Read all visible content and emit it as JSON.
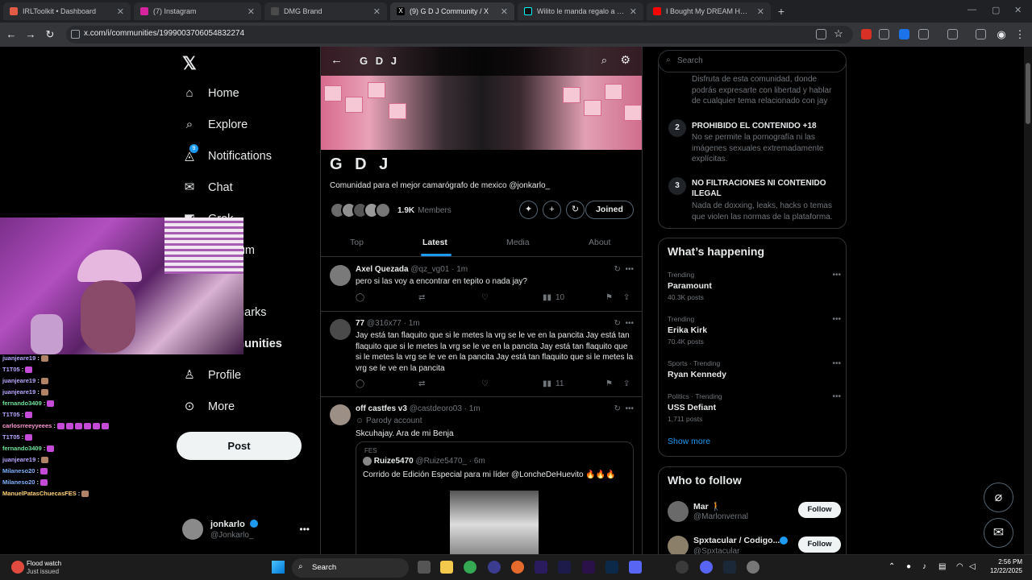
{
  "browser": {
    "tabs": [
      {
        "label": "IRLToolkit • Dashboard",
        "color": "#e25b45"
      },
      {
        "label": "(7) Instagram",
        "color": "#d6249f"
      },
      {
        "label": "DMG Brand",
        "color": "#4a4a4a"
      },
      {
        "label": "(9) G D J Community / X",
        "color": "#000000"
      },
      {
        "label": "Wilito le manda regalo a Sabina",
        "color": "#111111"
      },
      {
        "label": "I Bought My DREAM HOUSE At",
        "color": "#ff0000"
      }
    ],
    "url": "x.com/i/communities/1999003706054832274"
  },
  "nav": {
    "items": [
      {
        "label": "Home",
        "icon": "home-icon",
        "glyph": "⌂"
      },
      {
        "label": "Explore",
        "icon": "search-icon",
        "glyph": "⌕"
      },
      {
        "label": "Notifications",
        "icon": "bell-icon",
        "glyph": "🔔"
      },
      {
        "label": "Chat",
        "icon": "mail-icon",
        "glyph": "✉"
      },
      {
        "label": "Grok",
        "icon": "grok-icon",
        "glyph": "◩"
      },
      {
        "label": "Premium",
        "icon": "x-icon",
        "glyph": "✕"
      },
      {
        "label": "Bookmarks",
        "icon": "bookmark-icon",
        "glyph": "⚑"
      },
      {
        "label": "Communities",
        "icon": "communities-icon",
        "glyph": "👥"
      },
      {
        "label": "Profile",
        "icon": "profile-icon",
        "glyph": "👤"
      },
      {
        "label": "More",
        "icon": "more-icon",
        "glyph": "⋯"
      }
    ],
    "notifications_badge": "9",
    "post_label": "Post",
    "account": {
      "name": "jonkarlo",
      "handle": "@Jonkarlo_"
    }
  },
  "community": {
    "header_title": "G D J",
    "name": "G D J",
    "description": "Comunidad para el mejor camarógrafo de mexico @jonkarlo_",
    "member_count": "1.9K",
    "members_label": "Members",
    "joined_label": "Joined",
    "tabs": [
      "Top",
      "Latest",
      "Media",
      "About"
    ],
    "active_tab": "Latest"
  },
  "tweets": [
    {
      "name": "Axel Quezada",
      "handle": "@qz_vg01",
      "time": "· 1m",
      "text": "pero si las voy a encontrar en tepito o nada jay?",
      "views": "10"
    },
    {
      "name": "77",
      "handle": "@316x77",
      "time": "· 1m",
      "text": "Jay está tan flaquito que si le metes la vrg se le ve en la pancita Jay está tan flaquito que si le metes la vrg se le ve en la pancita Jay está tan flaquito que si le metes la vrg se le ve en la pancita Jay está tan flaquito que si le metes la vrg se le ve en la pancita",
      "views": "11"
    },
    {
      "name": "off castfes v3",
      "handle": "@castdeoro03",
      "time": "· 1m",
      "parody": "Parody account",
      "text": "Skcuhajay. Ara de mi Benja",
      "quote": {
        "label": "FES",
        "name": "Ruize5470",
        "handle": "@Ruize5470_",
        "time": "· 6m",
        "text": "Corrido de Edición Especial para mi líder @LoncheDeHuevito 🔥🔥🔥"
      }
    }
  ],
  "right": {
    "search_placeholder": "Search",
    "rules": [
      {
        "num": "",
        "title": "",
        "desc": "Disfruta de esta comunidad, donde podrás expresarte con libertad y hablar de cualquier tema relacionado con jay"
      },
      {
        "num": "2",
        "title": "PROHIBIDO EL CONTENIDO +18",
        "desc": "No se permite la pornografía ni las imágenes sexuales extremadamente explícitas."
      },
      {
        "num": "3",
        "title": "NO FILTRACIONES NI CONTENIDO ILEGAL",
        "desc": "Nada de doxxing, leaks, hacks o temas que violen las normas de la plataforma."
      }
    ],
    "happening_title": "What’s happening",
    "trends": [
      {
        "cat": "Trending",
        "title": "Paramount",
        "posts": "40.3K posts"
      },
      {
        "cat": "Trending",
        "title": "Erika Kirk",
        "posts": "70.4K posts"
      },
      {
        "cat": "Sports · Trending",
        "title": "Ryan Kennedy",
        "posts": ""
      },
      {
        "cat": "Politics · Trending",
        "title": "USS Defiant",
        "posts": "1,711 posts"
      }
    ],
    "show_more": "Show more",
    "who_title": "Who to follow",
    "follows": [
      {
        "name": "Mar 🚶",
        "handle": "@Marlonvernal",
        "btn": "Follow"
      },
      {
        "name": "Spxtacular / Codigo...",
        "handle": "@Spxtacular",
        "btn": "Follow"
      }
    ]
  },
  "stream_chat": [
    {
      "user": "juanjeare19",
      "msg": " :"
    },
    {
      "user": "T1T05",
      "msg": " :"
    },
    {
      "user": "juanjeare19",
      "msg": " :"
    },
    {
      "user": "juanjeare19",
      "msg": " :"
    },
    {
      "user": "fernando3409",
      "msg": " :"
    },
    {
      "user": "T1T05",
      "msg": " :"
    },
    {
      "user": "carlosrreeyyeees",
      "msg": " :"
    },
    {
      "user": "T1T05",
      "msg": " :"
    },
    {
      "user": "fernando3409",
      "msg": " :"
    },
    {
      "user": "juanjeare19",
      "msg": " :"
    },
    {
      "user": "Milaneso20",
      "msg": " :"
    },
    {
      "user": "Milaneso20",
      "msg": " :"
    },
    {
      "user": "ManuelPatasChuecasFES",
      "msg": " :"
    }
  ],
  "taskbar": {
    "weather_title": "Flood watch",
    "weather_sub": "Just issued",
    "search_label": "Search",
    "time": "2:56 PM",
    "date": "12/22/2025"
  }
}
